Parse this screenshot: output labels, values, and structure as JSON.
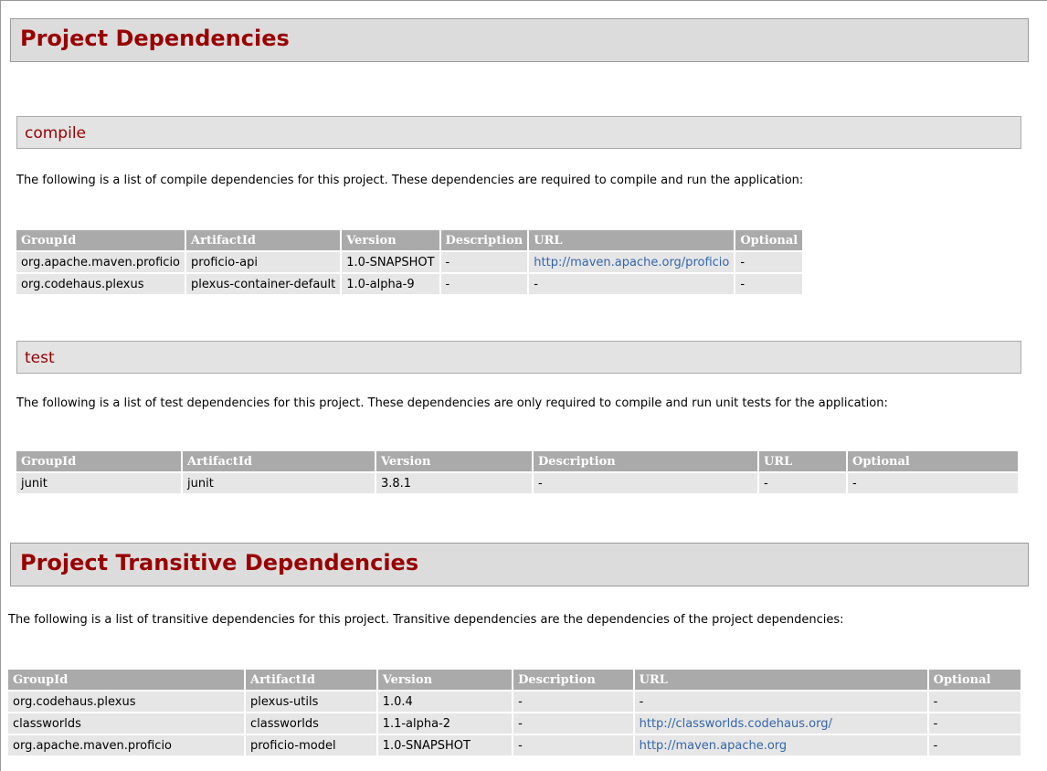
{
  "project_dependencies": {
    "title": "Project Dependencies",
    "compile": {
      "title": "compile",
      "description": "The following is a list of compile dependencies for this project. These dependencies are required to compile and run the application:",
      "headers": [
        "GroupId",
        "ArtifactId",
        "Version",
        "Description",
        "URL",
        "Optional"
      ],
      "rows": [
        [
          "org.apache.maven.proficio",
          "proficio-api",
          "1.0-SNAPSHOT",
          "-",
          "http://maven.apache.org/proficio",
          "-"
        ],
        [
          "org.codehaus.plexus",
          "plexus-container-default",
          "1.0-alpha-9",
          "-",
          "-",
          "-"
        ]
      ]
    },
    "test": {
      "title": "test",
      "description": "The following is a list of test dependencies for this project. These dependencies are only required to compile and run unit tests for the application:",
      "headers": [
        "GroupId",
        "ArtifactId",
        "Version",
        "Description",
        "URL",
        "Optional"
      ],
      "rows": [
        [
          "junit",
          "junit",
          "3.8.1",
          "-",
          "-",
          "-"
        ]
      ]
    }
  },
  "transitive_dependencies": {
    "title": "Project Transitive Dependencies",
    "description": "The following is a list of transitive dependencies for this project. Transitive dependencies are the dependencies of the project dependencies:",
    "headers": [
      "GroupId",
      "ArtifactId",
      "Version",
      "Description",
      "URL",
      "Optional"
    ],
    "rows": [
      [
        "org.codehaus.plexus",
        "plexus-utils",
        "1.0.4",
        "-",
        "-",
        "-"
      ],
      [
        "classworlds",
        "classworlds",
        "1.1-alpha-2",
        "-",
        "http://classworlds.codehaus.org/",
        "-"
      ],
      [
        "org.apache.maven.proficio",
        "proficio-model",
        "1.0-SNAPSHOT",
        "-",
        "http://maven.apache.org",
        "-"
      ]
    ]
  },
  "colors": {
    "heading": "#990000",
    "link": "#3366aa",
    "table_header": "#aaaaaa",
    "table_cell": "#e6e6e6"
  }
}
